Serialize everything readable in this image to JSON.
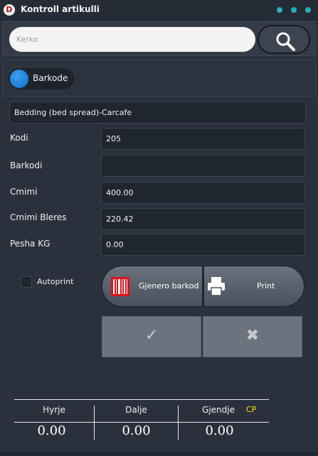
{
  "window": {
    "app_icon_letter": "D",
    "title": "Kontroll artikulli"
  },
  "search": {
    "placeholder": "Kerko",
    "value": ""
  },
  "barkode_toggle": {
    "label": "Barkode"
  },
  "article_name": "Bedding (bed spread)-Carcafe",
  "fields": {
    "kodi": {
      "label": "Kodi",
      "value": "205"
    },
    "barkodi": {
      "label": "Barkodi",
      "value": ""
    },
    "cmimi": {
      "label": "Cmimi",
      "value": "400.00"
    },
    "cmimi_bleres": {
      "label": "Cmimi Bleres",
      "value": "220.42"
    },
    "pesha_kg": {
      "label": "Pesha KG",
      "value": "0.00"
    }
  },
  "autoprint": {
    "label": "Autoprint",
    "checked": false
  },
  "actions": {
    "gjenero_barkod": "Gjenero barkod",
    "print": "Print",
    "confirm_glyph": "✓",
    "cancel_glyph": "✖"
  },
  "totals": {
    "hyrje": {
      "label": "Hyrje",
      "value": "0.00"
    },
    "dalje": {
      "label": "Dalje",
      "value": "0.00"
    },
    "gjendje": {
      "label": "Gjendje",
      "value": "0.00"
    },
    "cp_label": "CP"
  },
  "colors": {
    "background": "#2b313c",
    "accent_teal": "#1fb3b8",
    "toggle_blue": "#0d6fc8",
    "cp_yellow": "#f2e600",
    "barcode_red": "#d8141c"
  },
  "icons": {
    "app": "app-logo-icon",
    "window_menu": "dots-menu-icon",
    "search": "magnifier-icon",
    "barcode": "barcode-icon",
    "print": "printer-icon",
    "confirm": "checkmark-icon",
    "cancel": "x-icon"
  }
}
